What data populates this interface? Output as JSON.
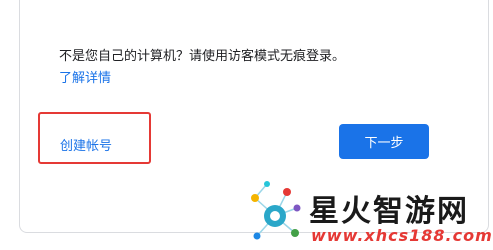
{
  "signin": {
    "guest_message": "不是您自己的计算机？请使用访客模式无痕登录。",
    "learn_more_link": "了解详情",
    "create_account_button": "创建帐号",
    "next_button": "下一步"
  },
  "watermark": {
    "site_name": "星火智游网",
    "site_url": "www.xhcs188.com"
  },
  "colors": {
    "accent": "#1a73e8",
    "highlight_box": "#e53935",
    "watermark_url": "#e53935"
  }
}
